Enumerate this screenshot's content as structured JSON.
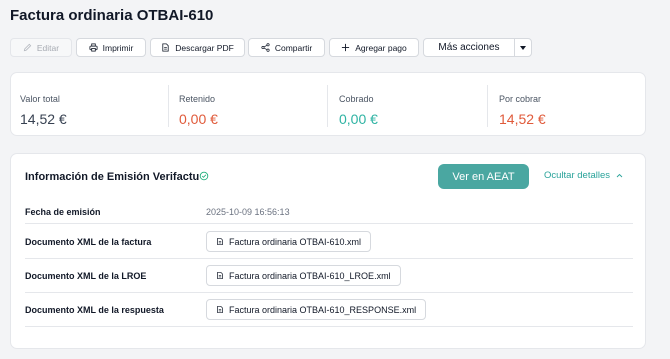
{
  "page": {
    "title": "Factura ordinaria OTBAI-610"
  },
  "toolbar": {
    "edit_label": "Editar",
    "print_label": "Imprimir",
    "download_label": "Descargar PDF",
    "share_label": "Compartir",
    "add_payment_label": "Agregar pago",
    "more_actions_label": "Más acciones"
  },
  "summary": {
    "valor_total": {
      "label": "Valor total",
      "value": "14,52 €",
      "color": "#374151"
    },
    "retenido": {
      "label": "Retenido",
      "value": "0,00 €",
      "color": "#e05a3a"
    },
    "cobrado": {
      "label": "Cobrado",
      "value": "0,00 €",
      "color": "#2eb3a3"
    },
    "por_cobrar": {
      "label": "Por cobrar",
      "value": "14,52 €",
      "color": "#e05a3a"
    }
  },
  "details": {
    "title": "Información de Emisión Verifactu",
    "status_icon": "check-circle-icon",
    "view_button_label": "Ver en AEAT",
    "hide_link_label": "Ocultar detalles",
    "rows": [
      {
        "label": "Fecha de emisión",
        "value": "2025-10-09 16:56:13"
      },
      {
        "label": "Documento XML de la factura",
        "file": "Factura ordinaria OTBAI-610.xml"
      },
      {
        "label": "Documento XML de la LROE",
        "file": "Factura ordinaria OTBAI-610_LROE.xml"
      },
      {
        "label": "Documento XML de la respuesta",
        "file": "Factura ordinaria OTBAI-610_RESPONSE.xml"
      }
    ]
  },
  "colors": {
    "accent": "#4aa7a1",
    "link": "#2aa39a",
    "negative": "#e05a3a",
    "positive": "#2eb3a3"
  }
}
